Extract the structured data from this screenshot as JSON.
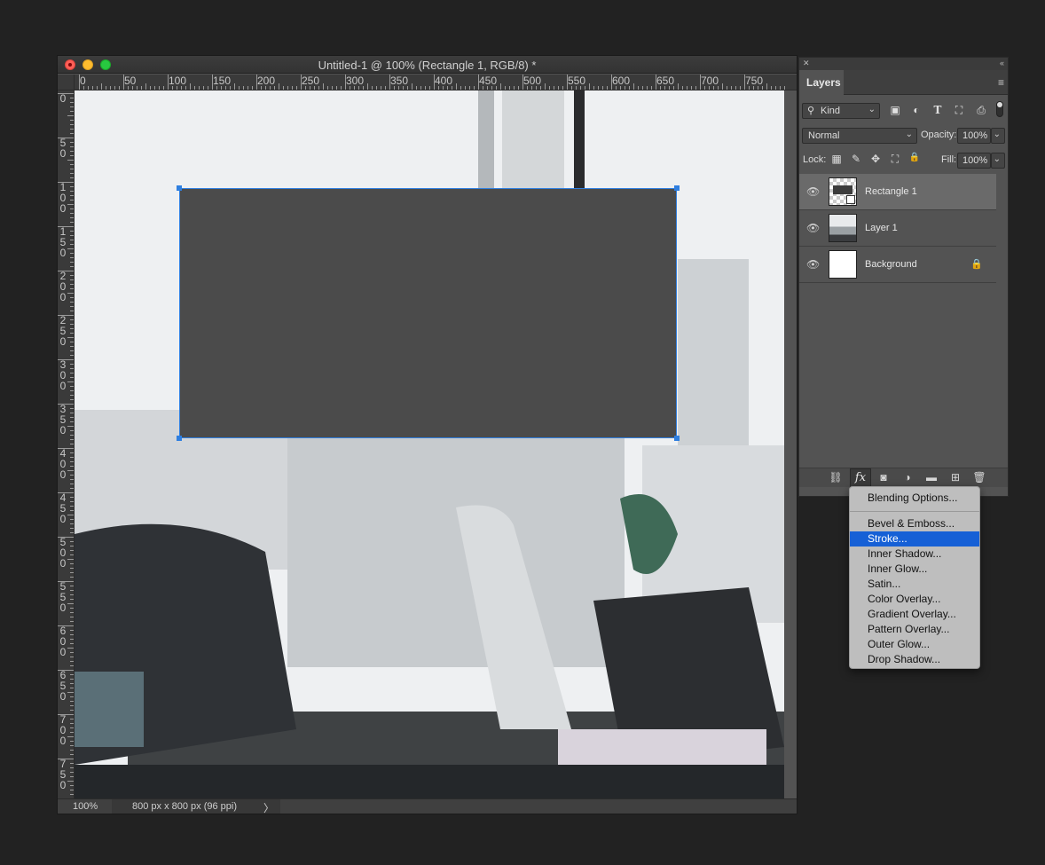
{
  "document": {
    "title": "Untitled-1 @ 100% (Rectangle 1, RGB/8) *",
    "status_zoom": "100%",
    "status_size": "800 px x 800 px (96 ppi)",
    "status_arrow": "〉"
  },
  "ruler": {
    "top_labels": [
      "0",
      "50",
      "100",
      "150",
      "200",
      "250",
      "300",
      "350",
      "400",
      "450",
      "500",
      "550",
      "600",
      "650",
      "700",
      "750"
    ],
    "left_labels": [
      "0",
      "50",
      "100",
      "150",
      "200",
      "250",
      "300",
      "350",
      "400",
      "450",
      "500",
      "550",
      "600",
      "650",
      "700",
      "750"
    ]
  },
  "canvas": {
    "selected_layer": "Rectangle 1",
    "rect_color": "#4b4b4b",
    "selection_color": "#2f7fe0"
  },
  "layers_panel": {
    "tab": "Layers",
    "menu_icon": "≡",
    "close_icon": "✕",
    "collapse_icon": "«",
    "filter_kind": "Kind",
    "filter_search_icon": "⚲",
    "chevron": "⌄",
    "filter_icons": [
      "image-filter-icon",
      "adjustment-filter-icon",
      "type-filter-icon",
      "shape-filter-icon",
      "smart-object-filter-icon"
    ],
    "filter_glyphs": [
      "▣",
      "◐",
      "T",
      "⛶",
      "⎙"
    ],
    "blend_mode": "Normal",
    "opacity_label": "Opacity:",
    "opacity_value": "100%",
    "lock_label": "Lock:",
    "lock_glyphs": [
      "▦",
      "✎",
      "✥",
      "⛶",
      "🔒"
    ],
    "fill_label": "Fill:",
    "fill_value": "100%",
    "eye_glyph": "👁",
    "lock_badge": "🔒",
    "layers": [
      {
        "name": "Rectangle 1",
        "selected": true
      },
      {
        "name": "Layer 1",
        "selected": false
      },
      {
        "name": "Background",
        "selected": false,
        "locked": true
      }
    ],
    "footer_glyphs": [
      "⛓",
      "fx",
      "◙",
      "◑",
      "▬",
      "⊞",
      "🗑"
    ],
    "accent": "#1660d6"
  },
  "fx_menu": {
    "items": [
      "Blending Options...",
      "Bevel & Emboss...",
      "Stroke...",
      "Inner Shadow...",
      "Inner Glow...",
      "Satin...",
      "Color Overlay...",
      "Gradient Overlay...",
      "Pattern Overlay...",
      "Outer Glow...",
      "Drop Shadow..."
    ],
    "selected": "Stroke..."
  }
}
